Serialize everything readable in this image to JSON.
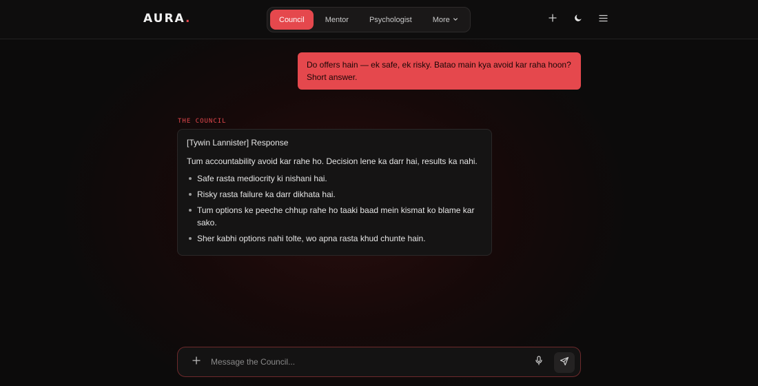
{
  "brand": {
    "name": "AURA",
    "dot": "."
  },
  "nav": {
    "tabs": [
      {
        "label": "Council",
        "active": true
      },
      {
        "label": "Mentor",
        "active": false
      },
      {
        "label": "Psychologist",
        "active": false
      },
      {
        "label": "More",
        "active": false
      }
    ]
  },
  "header_icons": [
    "plus-icon",
    "moon-icon",
    "menu-icon"
  ],
  "conversation": {
    "user_message": "Do offers hain — ek safe, ek risky. Batao main kya avoid kar raha hoon? Short answer.",
    "council": {
      "label": "THE COUNCIL",
      "heading": "[Tywin Lannister] Response",
      "paragraph": "Tum accountability avoid kar rahe ho. Decision lene ka darr hai, results ka nahi.",
      "bullets": [
        "Safe rasta mediocrity ki nishani hai.",
        "Risky rasta failure ka darr dikhata hai.",
        "Tum options ke peeche chhup rahe ho taaki baad mein kismat ko blame kar sako.",
        "Sher kabhi options nahi tolte, wo apna rasta khud chunte hain."
      ]
    }
  },
  "composer": {
    "placeholder": "Message the Council...",
    "value": ""
  },
  "colors": {
    "accent": "#e5484d",
    "background": "#0c0b0b",
    "card": "#151414"
  }
}
